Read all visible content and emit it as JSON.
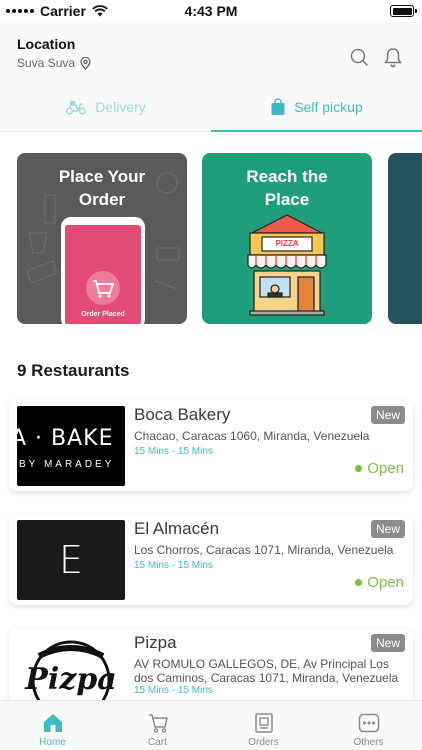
{
  "status_bar": {
    "carrier": "Carrier",
    "time": "4:43 PM"
  },
  "header": {
    "location_label": "Location",
    "location_value": "Suva Suva"
  },
  "tabs": [
    {
      "label": "Delivery",
      "active": false
    },
    {
      "label": "Self pickup",
      "active": true
    }
  ],
  "banners": [
    {
      "title_line1": "Place Your",
      "title_line2": "Order",
      "phone_caption": "Order Placed"
    },
    {
      "title_line1": "Reach the",
      "title_line2": "Place",
      "sign": "PIZZA"
    }
  ],
  "section_title": "9 Restaurants",
  "restaurants": [
    {
      "name": "Boca Bakery",
      "address": "Chacao, Caracas 1060, Miranda, Venezuela",
      "time": "15  Mins - 15  Mins",
      "badge": "New",
      "status": "Open",
      "logo_line1": "A · BAKE",
      "logo_line2": "BY MARADEY"
    },
    {
      "name": "El Almacén",
      "address": "Los Chorros, Caracas 1071, Miranda, Venezuela",
      "time": "15  Mins - 15  Mins",
      "badge": "New",
      "status": "Open",
      "logo_line1": "E"
    },
    {
      "name": "Pizpa",
      "address": "AV ROMULO GALLEGOS, DE, Av Principal Los dos Caminos, Caracas 1071, Miranda, Venezuela",
      "time": "15  Mins - 15  Mins",
      "badge": "New",
      "logo_line1": "Pizpa"
    }
  ],
  "bottom_nav": [
    {
      "label": "Home",
      "icon": "home-icon",
      "active": true
    },
    {
      "label": "Cart",
      "icon": "cart-icon",
      "active": false
    },
    {
      "label": "Orders",
      "icon": "orders-icon",
      "active": false
    },
    {
      "label": "Others",
      "icon": "others-icon",
      "active": false
    }
  ],
  "colors": {
    "accent": "#3cbcc0",
    "open_green": "#78c043",
    "badge_gray": "#8c8c8c",
    "banner_dark": "#5b5a5b",
    "banner_green": "#1f9e7c"
  }
}
